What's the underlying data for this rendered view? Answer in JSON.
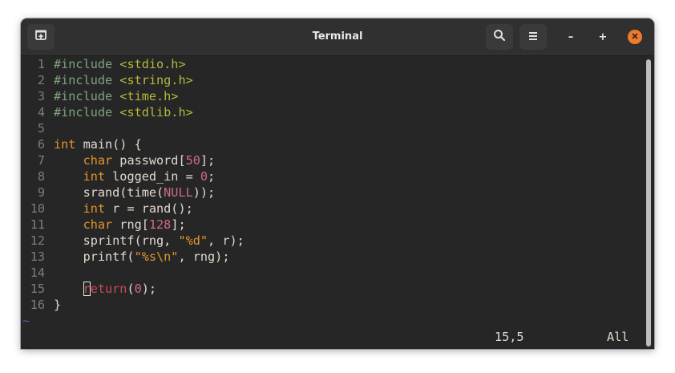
{
  "window": {
    "title": "Terminal"
  },
  "headerbar": {
    "new_tab_icon": "new-tab-icon",
    "search_icon": "search-icon",
    "menu_icon": "hamburger-menu-icon",
    "minimize_label": "–",
    "maximize_label": "+",
    "close_icon": "close-icon"
  },
  "colors": {
    "preproc": "#7fa37f",
    "include_path": "#b5b83c",
    "type_keyword": "#e3952c",
    "number": "#cf6a87",
    "string": "#e3952c",
    "escape": "#e3952c",
    "plain": "#e2d8cc",
    "return_keyword": "#c74b5a",
    "line_number": "#7d7d7d",
    "tilde": "#4f63a8",
    "close_button": "#ee7a2b"
  },
  "editor": {
    "lines": [
      {
        "n": "1",
        "tokens": [
          {
            "t": "#include ",
            "c": "preproc"
          },
          {
            "t": "<stdio.h>",
            "c": "include_path"
          }
        ]
      },
      {
        "n": "2",
        "tokens": [
          {
            "t": "#include ",
            "c": "preproc"
          },
          {
            "t": "<string.h>",
            "c": "include_path"
          }
        ]
      },
      {
        "n": "3",
        "tokens": [
          {
            "t": "#include ",
            "c": "preproc"
          },
          {
            "t": "<time.h>",
            "c": "include_path"
          }
        ]
      },
      {
        "n": "4",
        "tokens": [
          {
            "t": "#include ",
            "c": "preproc"
          },
          {
            "t": "<stdlib.h>",
            "c": "include_path"
          }
        ]
      },
      {
        "n": "5",
        "tokens": []
      },
      {
        "n": "6",
        "tokens": [
          {
            "t": "int",
            "c": "type_keyword"
          },
          {
            "t": " main() {",
            "c": "plain"
          }
        ]
      },
      {
        "n": "7",
        "tokens": [
          {
            "t": "    ",
            "c": "plain"
          },
          {
            "t": "char",
            "c": "type_keyword"
          },
          {
            "t": " password[",
            "c": "plain"
          },
          {
            "t": "50",
            "c": "number"
          },
          {
            "t": "];",
            "c": "plain"
          }
        ]
      },
      {
        "n": "8",
        "tokens": [
          {
            "t": "    ",
            "c": "plain"
          },
          {
            "t": "int",
            "c": "type_keyword"
          },
          {
            "t": " logged_in = ",
            "c": "plain"
          },
          {
            "t": "0",
            "c": "number"
          },
          {
            "t": ";",
            "c": "plain"
          }
        ]
      },
      {
        "n": "9",
        "tokens": [
          {
            "t": "    srand(time(",
            "c": "plain"
          },
          {
            "t": "NULL",
            "c": "number"
          },
          {
            "t": "));",
            "c": "plain"
          }
        ]
      },
      {
        "n": "10",
        "tokens": [
          {
            "t": "    ",
            "c": "plain"
          },
          {
            "t": "int",
            "c": "type_keyword"
          },
          {
            "t": " r = rand();",
            "c": "plain"
          }
        ]
      },
      {
        "n": "11",
        "tokens": [
          {
            "t": "    ",
            "c": "plain"
          },
          {
            "t": "char",
            "c": "type_keyword"
          },
          {
            "t": " rng[",
            "c": "plain"
          },
          {
            "t": "128",
            "c": "number"
          },
          {
            "t": "];",
            "c": "plain"
          }
        ]
      },
      {
        "n": "12",
        "tokens": [
          {
            "t": "    sprintf(rng, ",
            "c": "plain"
          },
          {
            "t": "\"%d\"",
            "c": "string"
          },
          {
            "t": ", r);",
            "c": "plain"
          }
        ]
      },
      {
        "n": "13",
        "tokens": [
          {
            "t": "    printf(",
            "c": "plain"
          },
          {
            "t": "\"%s\\n\"",
            "c": "string"
          },
          {
            "t": ", rng);",
            "c": "plain"
          }
        ]
      },
      {
        "n": "14",
        "tokens": []
      },
      {
        "n": "15",
        "tokens": [
          {
            "t": "    ",
            "c": "plain"
          },
          {
            "t": "r",
            "c": "return_keyword",
            "cursor": true
          },
          {
            "t": "eturn",
            "c": "return_keyword"
          },
          {
            "t": "(",
            "c": "plain"
          },
          {
            "t": "0",
            "c": "number"
          },
          {
            "t": ");",
            "c": "plain"
          }
        ]
      },
      {
        "n": "16",
        "tokens": [
          {
            "t": "}",
            "c": "plain"
          }
        ]
      }
    ],
    "tilde": "~",
    "status_position": "15,5",
    "status_scroll": "All"
  }
}
